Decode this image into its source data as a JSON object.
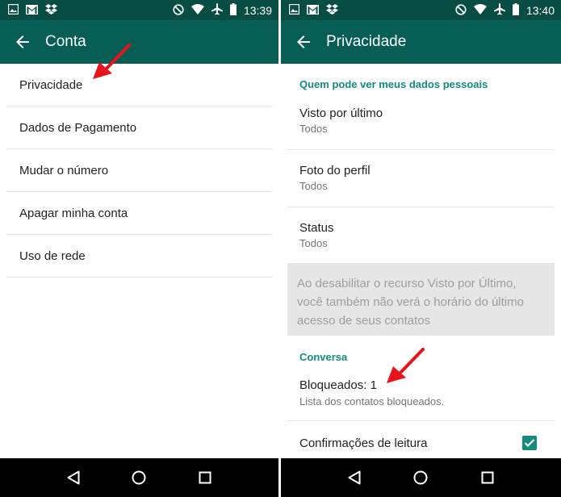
{
  "left": {
    "status_time": "13:39",
    "title": "Conta",
    "menu": [
      {
        "label": "Privacidade"
      },
      {
        "label": "Dados de Pagamento"
      },
      {
        "label": "Mudar o número"
      },
      {
        "label": "Apagar minha conta"
      },
      {
        "label": "Uso de rede"
      }
    ]
  },
  "right": {
    "status_time": "13:40",
    "title": "Privacidade",
    "section_personal": "Quem pode ver meus dados pessoais",
    "visto": {
      "title": "Visto por último",
      "value": "Todos"
    },
    "foto": {
      "title": "Foto do perfil",
      "value": "Todos"
    },
    "status": {
      "title": "Status",
      "value": "Todos"
    },
    "info": "Ao desabilitar o recurso Visto por Último, você também não verá o horário do último acesso de seus contatos",
    "section_chat": "Conversa",
    "bloqueados": {
      "title": "Bloqueados: 1",
      "subtitle": "Lista dos contatos bloqueados."
    },
    "read_receipts": {
      "title": "Confirmações de leitura",
      "checked": true
    }
  },
  "colors": {
    "statusbar": "#074d43",
    "appbar": "#075e54",
    "accent": "#128c7e",
    "annotation_arrow": "#e8141b"
  },
  "icons": {
    "status_left": [
      "image-icon",
      "gmail-icon",
      "dropbox-icon"
    ],
    "status_right": [
      "do-not-disturb-icon",
      "wifi-icon",
      "airplane-icon",
      "battery-icon"
    ],
    "nav": [
      "back-triangle-icon",
      "home-circle-icon",
      "recents-square-icon"
    ]
  }
}
